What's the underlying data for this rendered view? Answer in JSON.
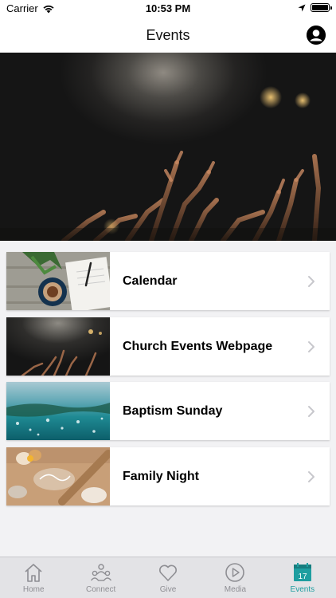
{
  "status_bar": {
    "carrier": "Carrier",
    "time": "10:53 PM"
  },
  "nav": {
    "title": "Events"
  },
  "events": [
    {
      "label": "Calendar"
    },
    {
      "label": "Church Events Webpage"
    },
    {
      "label": "Baptism Sunday"
    },
    {
      "label": "Family Night"
    }
  ],
  "tabs": [
    {
      "label": "Home",
      "icon": "home-icon"
    },
    {
      "label": "Connect",
      "icon": "people-icon"
    },
    {
      "label": "Give",
      "icon": "heart-icon"
    },
    {
      "label": "Media",
      "icon": "play-icon"
    },
    {
      "label": "Events",
      "icon": "calendar-icon",
      "icon_text": "17",
      "active": true
    }
  ],
  "colors": {
    "accent": "#1e9ea0",
    "inactive": "#8e8e93",
    "tab_background": "#e3e3e6"
  }
}
